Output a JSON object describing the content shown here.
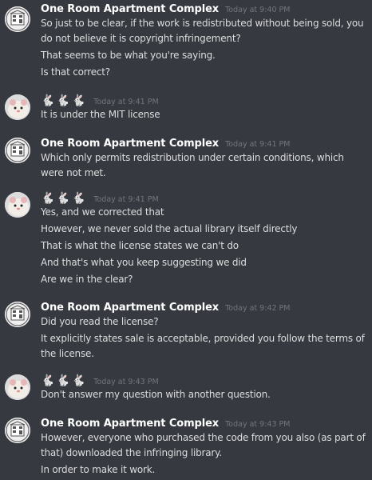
{
  "users": {
    "complex": {
      "name": "One Room Apartment Complex",
      "avatar_icon": "apartment-building-icon"
    },
    "bunnies": {
      "name": "🐇🐇🐇",
      "avatar_icon": "hamster-photo-icon"
    }
  },
  "messages": [
    {
      "username": "One Room Apartment Complex",
      "timestamp": "Today at 9:40 PM",
      "lines": [
        "So just to be clear, if the work is redistributed without being sold, you do not believe it is copyright infringement?",
        "That seems to be what you're saying.",
        "Is that correct?"
      ]
    },
    {
      "username": "🐇🐇🐇",
      "timestamp": "Today at 9:41 PM",
      "lines": [
        "It is under the MIT license"
      ]
    },
    {
      "username": "One Room Apartment Complex",
      "timestamp": "Today at 9:41 PM",
      "lines": [
        "Which only permits redistribution under certain conditions, which were not met."
      ]
    },
    {
      "username": "🐇🐇🐇",
      "timestamp": "Today at 9:41 PM",
      "lines": [
        "Yes, and we corrected that",
        "However, we never sold the actual library itself directly",
        "That is what the license states we can't do",
        "And that's what you keep suggesting we did",
        "Are we in the clear?"
      ]
    },
    {
      "username": "One Room Apartment Complex",
      "timestamp": "Today at 9:42 PM",
      "lines": [
        "Did you read the license?",
        "It explicitly states sale is acceptable, provided you follow the terms of the license."
      ]
    },
    {
      "username": "🐇🐇🐇",
      "timestamp": "Today at 9:43 PM",
      "lines": [
        "Don't answer my question with another question."
      ]
    },
    {
      "username": "One Room Apartment Complex",
      "timestamp": "Today at 9:43 PM",
      "lines": [
        "However, everyone who purchased the code from you also (as part of that) downloaded the infringing library.",
        "In order to make it work."
      ]
    }
  ]
}
